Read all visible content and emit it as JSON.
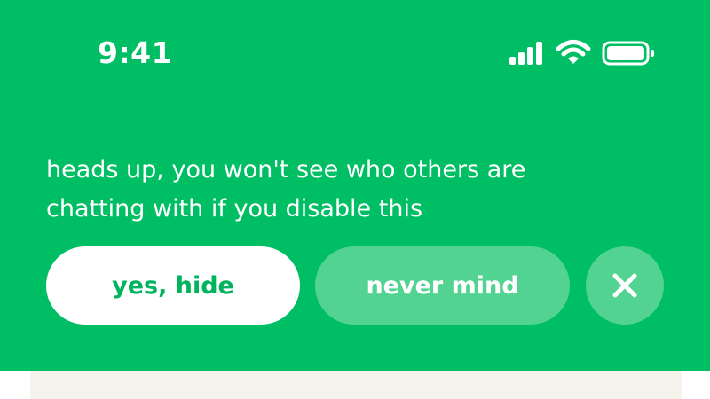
{
  "status_bar": {
    "time": "9:41",
    "icons": [
      "cellular-signal-icon",
      "wifi-icon",
      "battery-icon"
    ]
  },
  "banner": {
    "message": "heads up, you won't see who others are chatting with if you disable this",
    "buttons": {
      "confirm_label": "yes, hide",
      "cancel_label": "never mind",
      "close_icon": "close-icon"
    }
  },
  "colors": {
    "banner_bg": "#00be64",
    "button_secondary_bg": "#52d392",
    "confirm_text": "#00b35d",
    "underlay_bg": "#f5f3ec"
  }
}
